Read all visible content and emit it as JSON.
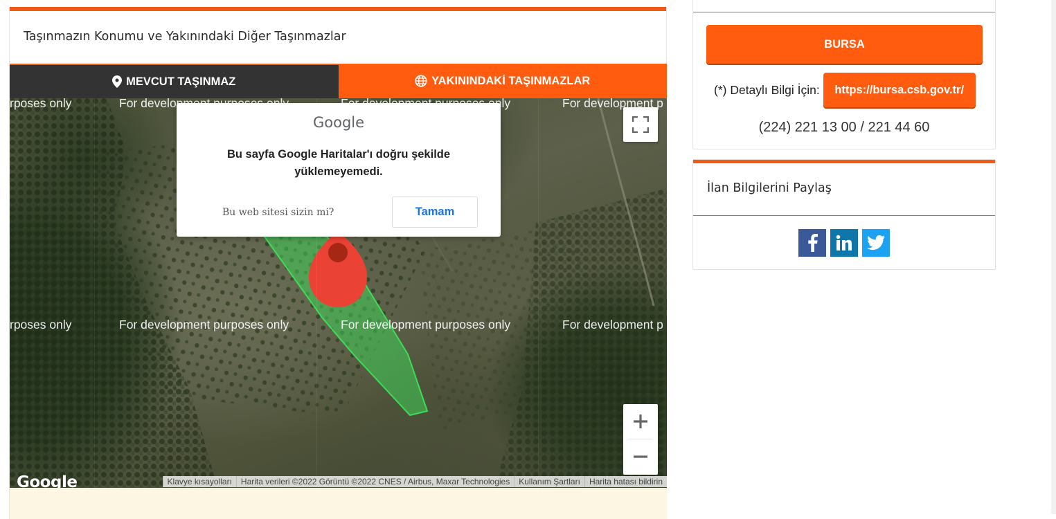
{
  "left": {
    "title": "Taşınmazın Konumu ve Yakınındaki Diğer Taşınmazlar",
    "tabs": [
      {
        "label": "MEVCUT TAŞINMAZ",
        "icon": "map-pin-icon"
      },
      {
        "label": "YAKININDAKİ TAŞINMAZLAR",
        "icon": "globe-icon"
      }
    ]
  },
  "map": {
    "watermark": "For development purposes only",
    "watermark_parts": {
      "left_clip": "rposes only",
      "right_clip": "For development p"
    },
    "dialog": {
      "logo": "Google",
      "message": "Bu sayfa Google Haritalar'ı doğru şekilde yüklemeyemedi.",
      "question": "Bu web sitesi sizin mi?",
      "ok_label": "Tamam"
    },
    "google_logo": "Google",
    "attribution": [
      "Klavye kısayolları",
      "Harita verileri ©2022 Görüntü ©2022 CNES / Airbus, Maxar Technologies",
      "Kullanım Şartları",
      "Harita hatası bildirin"
    ],
    "zoom_in": "+",
    "zoom_out": "−",
    "colors": {
      "parcel": "#3ddc5a",
      "marker": "#ea4335"
    }
  },
  "contact": {
    "city_button": "BURSA",
    "detail_label": "(*) Detaylı Bilgi İçin:",
    "url": "https://bursa.csb.gov.tr/",
    "phone": "(224) 221 13 00 / 221 44 60"
  },
  "share": {
    "title": "İlan Bilgilerini Paylaş",
    "networks": [
      "facebook-icon",
      "linkedin-icon",
      "twitter-icon"
    ]
  },
  "colors": {
    "accent": "#ff5c0f",
    "dark_tab": "#333333"
  }
}
